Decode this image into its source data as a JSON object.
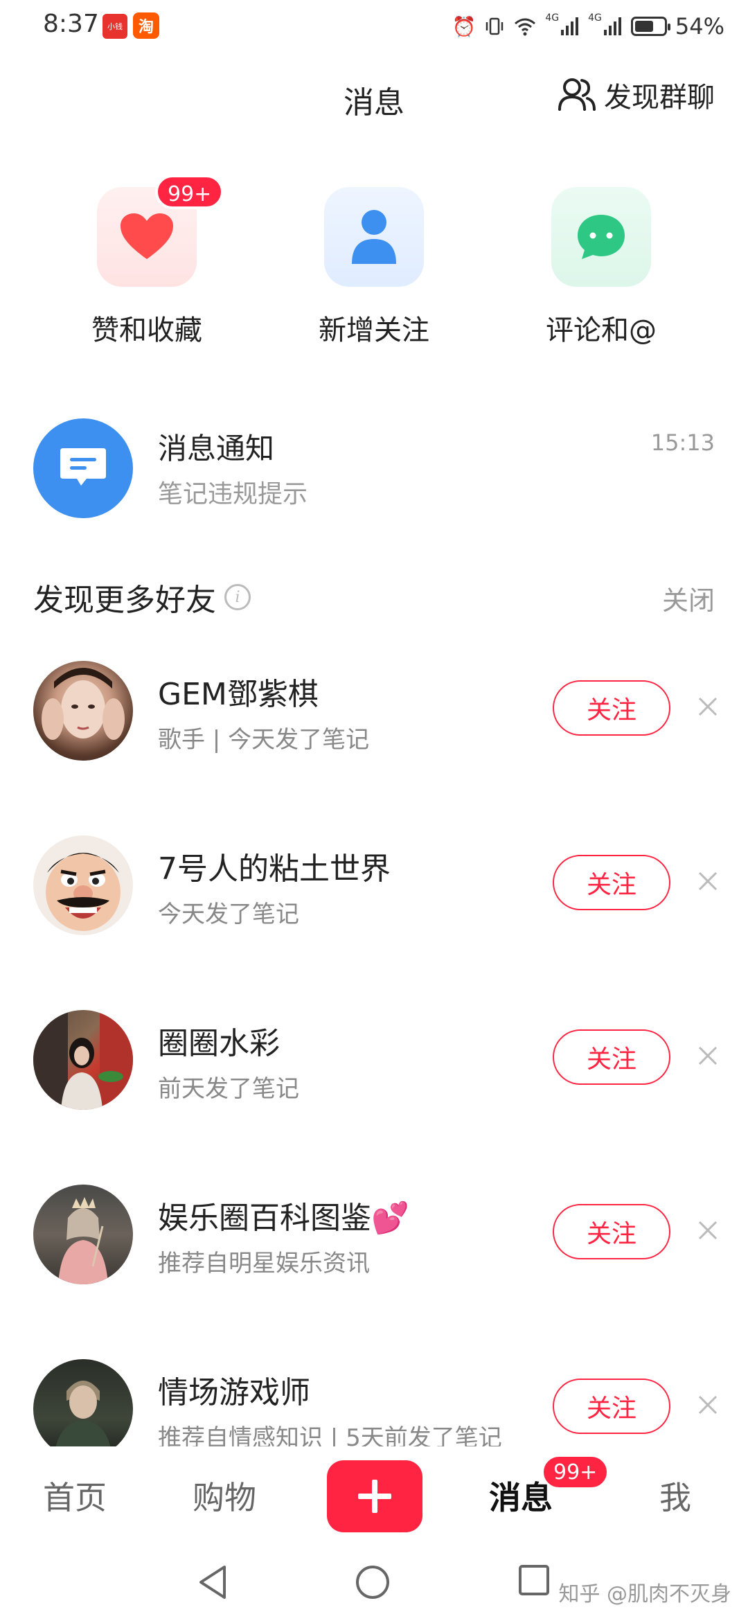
{
  "status_bar": {
    "time": "8:37",
    "app_badge_1": "小钱",
    "app_badge_2": "淘",
    "net_1": "4G",
    "net_2": "4G",
    "battery": "54%",
    "icons": [
      "alarm-icon",
      "vibrate-icon",
      "wifi-icon",
      "signal-icon",
      "signal-icon",
      "battery-icon"
    ]
  },
  "header": {
    "title": "消息",
    "find_group_label": "发现群聊"
  },
  "quick_actions": [
    {
      "label": "赞和收藏",
      "badge": "99+",
      "icon": "heart-icon",
      "color": "#ff4b4b"
    },
    {
      "label": "新增关注",
      "icon": "person-icon",
      "color": "#3d8ff0"
    },
    {
      "label": "评论和@",
      "icon": "chat-bubble-icon",
      "color": "#2ec783"
    }
  ],
  "notification": {
    "title": "消息通知",
    "subtitle": "笔记违规提示",
    "time": "15:13"
  },
  "discover": {
    "title": "发现更多好友",
    "close_label": "关闭"
  },
  "friends": [
    {
      "name": "GEM鄧紫棋",
      "desc": "歌手 | 今天发了笔记",
      "follow": "关注"
    },
    {
      "name": "7号人的粘土世界",
      "desc": "今天发了笔记",
      "follow": "关注"
    },
    {
      "name": "圈圈水彩",
      "desc": "前天发了笔记",
      "follow": "关注"
    },
    {
      "name": "娱乐圈百科图鉴💕",
      "desc": "推荐自明星娱乐资讯",
      "follow": "关注"
    },
    {
      "name": "情场游戏师",
      "desc": "推荐自情感知识 | 5天前发了笔记",
      "follow": "关注"
    }
  ],
  "bottom_nav": {
    "home": "首页",
    "shop": "购物",
    "messages": "消息",
    "messages_badge": "99+",
    "me": "我"
  },
  "watermark": "知乎 @肌肉不灭身"
}
